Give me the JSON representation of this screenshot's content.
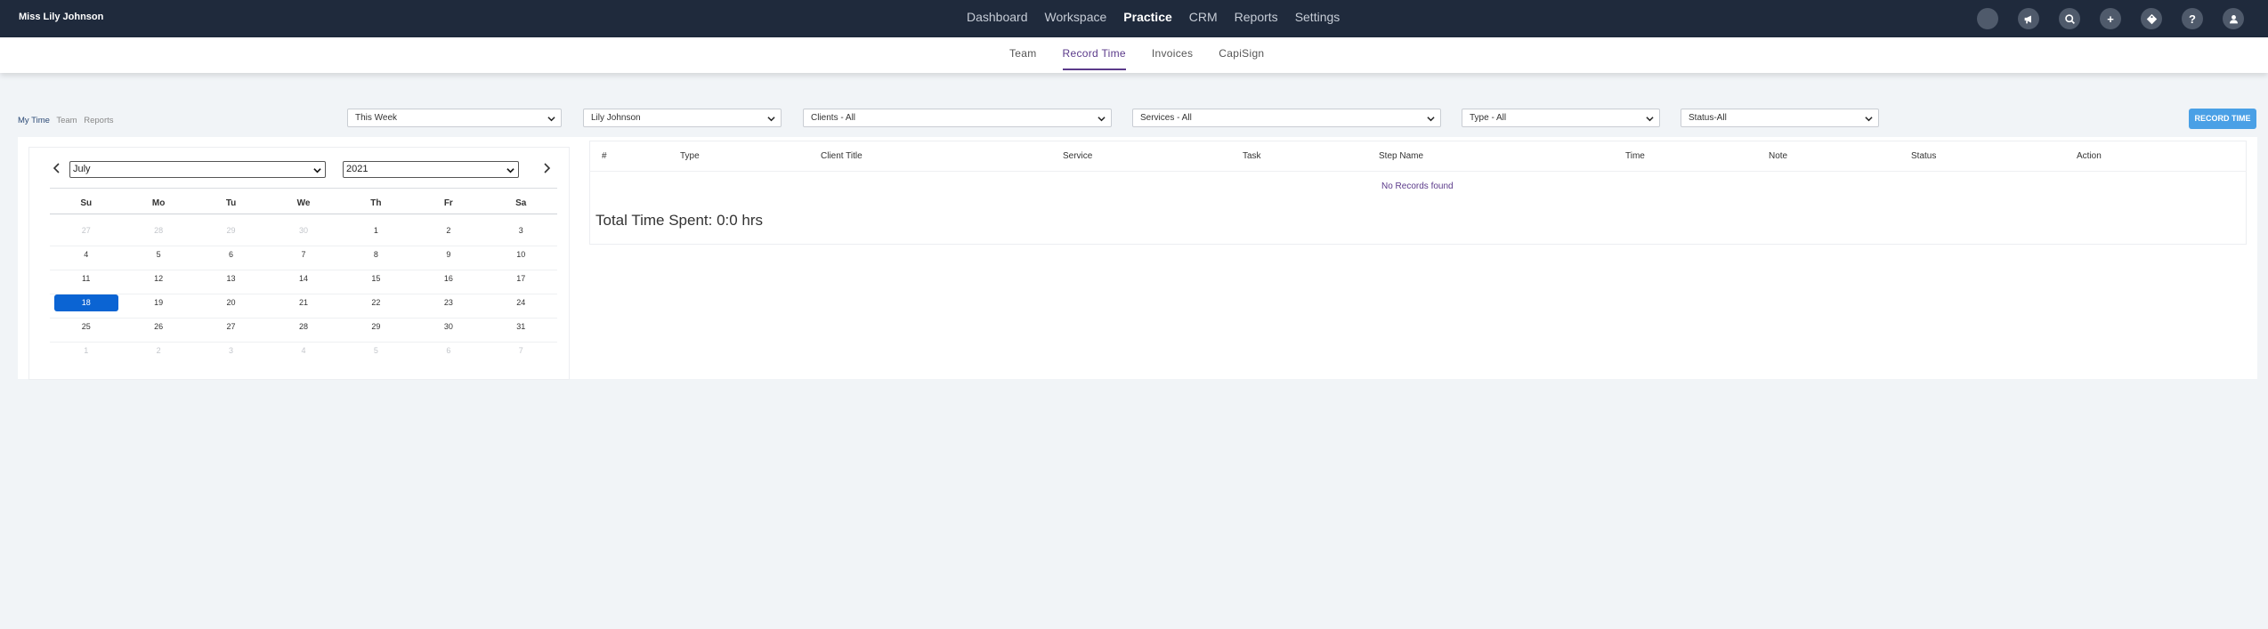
{
  "header": {
    "user_name": "Miss Lily Johnson",
    "nav": [
      "Dashboard",
      "Workspace",
      "Practice",
      "CRM",
      "Reports",
      "Settings"
    ],
    "active_nav": "Practice",
    "icons": [
      "avatar-circle-icon",
      "megaphone-icon",
      "search-icon",
      "plus-icon",
      "tag-icon",
      "help-icon",
      "user-icon"
    ],
    "help_glyph": "?",
    "plus_glyph": "+"
  },
  "subnav": {
    "tabs": [
      "Team",
      "Record Time",
      "Invoices",
      "CapiSign"
    ],
    "active": "Record Time"
  },
  "time_tabs": {
    "my_time": "My Time",
    "team": "Team",
    "reports": "Reports"
  },
  "filters": {
    "period": "This Week",
    "user": "Lily Johnson",
    "clients": "Clients - All",
    "services": "Services - All",
    "type": "Type - All",
    "status": "Status-All"
  },
  "record_button": "RECORD TIME",
  "calendar": {
    "month": "July",
    "year": "2021",
    "weekdays": [
      "Su",
      "Mo",
      "Tu",
      "We",
      "Th",
      "Fr",
      "Sa"
    ],
    "weeks": [
      [
        "27",
        "28",
        "29",
        "30",
        "1",
        "2",
        "3"
      ],
      [
        "4",
        "5",
        "6",
        "7",
        "8",
        "9",
        "10"
      ],
      [
        "11",
        "12",
        "13",
        "14",
        "15",
        "16",
        "17"
      ],
      [
        "18",
        "19",
        "20",
        "21",
        "22",
        "23",
        "24"
      ],
      [
        "25",
        "26",
        "27",
        "28",
        "29",
        "30",
        "31"
      ],
      [
        "1",
        "2",
        "3",
        "4",
        "5",
        "6",
        "7"
      ]
    ],
    "selected_day": "18",
    "prev_glyph": "‹",
    "next_glyph": "›"
  },
  "table": {
    "columns": [
      "#",
      "Type",
      "Client Title",
      "Service",
      "Task",
      "Step Name",
      "Time",
      "Note",
      "Status",
      "Action"
    ],
    "empty_message": "No Records found",
    "total": "Total Time Spent: 0:0 hrs"
  },
  "colors": {
    "topbar": "#1f2a3c",
    "accent_purple": "#5b3a8a",
    "button_blue": "#4aa0e6",
    "selected_day": "#0b64d3"
  }
}
